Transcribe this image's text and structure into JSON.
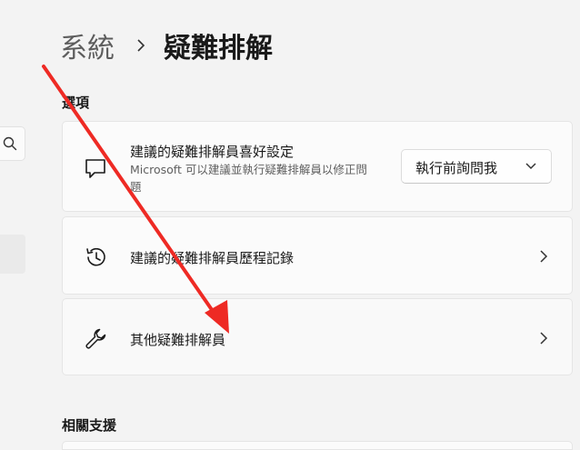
{
  "breadcrumb": {
    "parent": "系統",
    "current": "疑難排解"
  },
  "options_heading": "選項",
  "cards": [
    {
      "title": "建議的疑難排解員喜好設定",
      "description": "Microsoft 可以建議並執行疑難排解員以修正問題",
      "dropdown_value": "執行前詢問我",
      "icon": "chat-bubble-icon"
    },
    {
      "title": "建議的疑難排解員歷程記錄",
      "icon": "history-icon"
    },
    {
      "title": "其他疑難排解員",
      "icon": "wrench-icon"
    }
  ],
  "related_heading": "相關支援",
  "colors": {
    "background": "#f3f3f3",
    "card": "#fbfbfb",
    "annotation_arrow": "#ee2a24"
  }
}
